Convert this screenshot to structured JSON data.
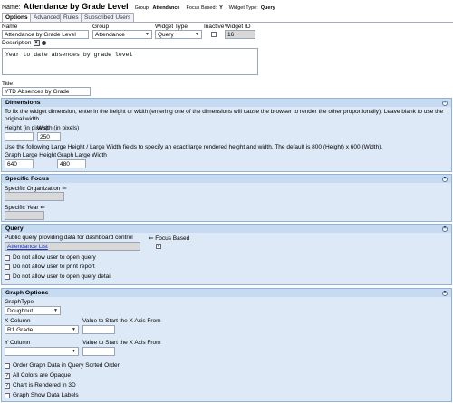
{
  "header": {
    "name_label": "Name:",
    "name_value": "Attendance by Grade Level",
    "group_label": "Group:",
    "group_value": "Attendance",
    "focus_label": "Focus Based:",
    "focus_value": "Y",
    "type_label": "Widget Type:",
    "type_value": "Query"
  },
  "tabs": [
    {
      "label": "Options"
    },
    {
      "label": "Advanced"
    },
    {
      "label": "Rules"
    },
    {
      "label": "Subscribed Users"
    }
  ],
  "options": {
    "name_label": "Name",
    "name_value": "Attendance by Grade Level",
    "group_label": "Group",
    "group_value": "Attendance",
    "widget_type_label": "Widget Type",
    "widget_type_value": "Query",
    "inactive_label": "Inactive",
    "widget_id_label": "Widget ID",
    "widget_id_value": "16",
    "description_label": "Description",
    "description_value": "Year to date absences by grade level",
    "title_label": "Title",
    "title_value": "YTD Absences by Grade"
  },
  "dimensions": {
    "title": "Dimensions",
    "instructions": "To fix the widget dimension, enter in the height or width (entering one of the dimensions will cause the browser to render the other proportionally). Leave blank to use the original width.",
    "height_label": "Height (in pixels)",
    "height_value": "",
    "width_label": "Width (in pixels)",
    "width_value": "250",
    "large_note": "Use the following Large Height / Large Width fields to specify an exact large rendered height and width. The default is 800 (Height) x 600 (Width).",
    "large_height_label": "Graph Large Height",
    "large_height_value": "640",
    "large_width_label": "Graph Large Width",
    "large_width_value": "480"
  },
  "specific_focus": {
    "title": "Specific Focus",
    "org_label": "Specific Organization",
    "year_label": "Specific Year"
  },
  "query": {
    "title": "Query",
    "public_label": "Public query providing data for dashboard control",
    "focus_based_label": "Focus Based",
    "query_value": "Attendance List",
    "opt1": "Do not allow user to open query",
    "opt2": "Do not allow user to print report",
    "opt3": "Do not allow user to open query detail"
  },
  "graph": {
    "title": "Graph Options",
    "graph_type_label": "GraphType",
    "graph_type_value": "Doughnut",
    "x_column_label": "X Column",
    "x_column_value": "R1 Grade",
    "x_start_label": "Value to Start the X Axis From",
    "y_column_label": "Y Column",
    "y_column_value": "",
    "y_start_label": "Value to Start the X Axis From",
    "opt_sorted": "Order Graph Data in Query Sorted Order",
    "opt_opaque": "All Colors are Opaque",
    "opt_3d": "Chart is Rendered in 3D",
    "opt_labels": "Graph Show Data Labels"
  },
  "colors": {
    "section_header": "#c6dbf1",
    "section_body": "#dde9f6",
    "link": "#1a36c4"
  }
}
